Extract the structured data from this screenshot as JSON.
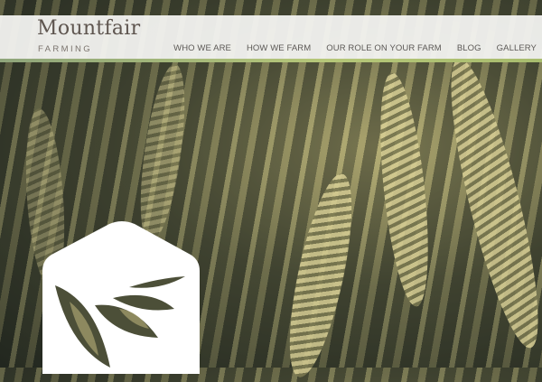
{
  "brand": {
    "title": "Mountfair",
    "subtitle": "FARMING"
  },
  "nav": {
    "items": [
      {
        "label": "WHO WE ARE"
      },
      {
        "label": "HOW WE FARM"
      },
      {
        "label": "OUR ROLE ON YOUR FARM"
      },
      {
        "label": "BLOG"
      },
      {
        "label": "GALLERY"
      }
    ]
  },
  "colors": {
    "accent_line": "#b6c779",
    "header_bg": "#f4f4f2",
    "logo_text": "#5e554f"
  },
  "icons": {
    "emblem": "hexagon-leaf-logo"
  }
}
